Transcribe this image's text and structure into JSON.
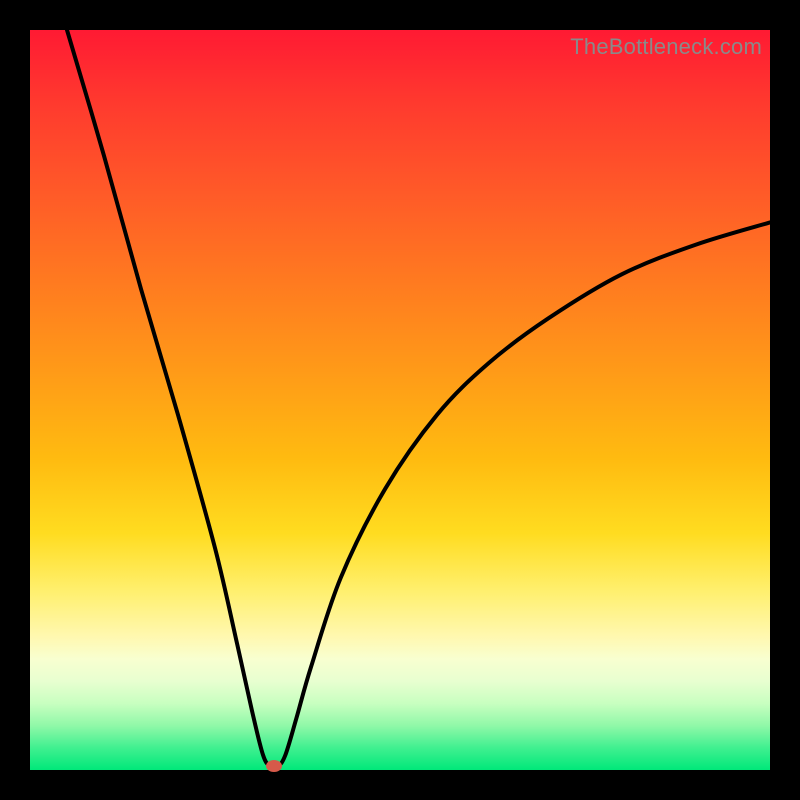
{
  "watermark": "TheBottleneck.com",
  "colors": {
    "curve": "#000000",
    "dot": "#d65a4a",
    "frame": "#000000"
  },
  "chart_data": {
    "type": "line",
    "title": "",
    "xlabel": "",
    "ylabel": "",
    "xlim": [
      0,
      100
    ],
    "ylim": [
      0,
      100
    ],
    "grid": false,
    "series": [
      {
        "name": "bottleneck-curve",
        "x": [
          5,
          10,
          15,
          20,
          25,
          28,
          30,
          31.5,
          32.5,
          33.5,
          34.5,
          36,
          38,
          42,
          48,
          55,
          62,
          70,
          80,
          90,
          100
        ],
        "y": [
          100,
          83,
          65,
          48,
          30,
          17,
          8,
          2,
          0.5,
          0.5,
          2,
          7,
          14,
          26,
          38,
          48,
          55,
          61,
          67,
          71,
          74
        ]
      }
    ],
    "marker": {
      "x": 33,
      "y": 0.5
    }
  }
}
